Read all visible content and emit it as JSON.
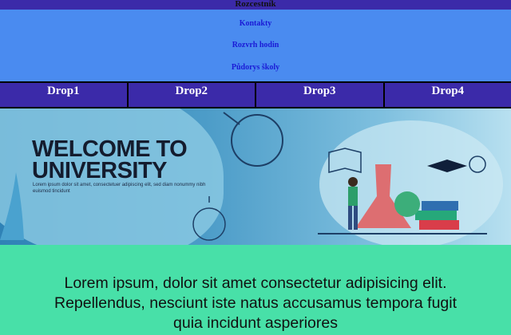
{
  "header": {
    "title": "Rozcestník"
  },
  "links": [
    "Kontakty",
    "Rozvrh hodin",
    "Půdorys školy"
  ],
  "dropdowns": [
    "Drop1",
    "Drop2",
    "Drop3",
    "Drop4"
  ],
  "banner": {
    "headline_line1": "WELCOME TO",
    "headline_line2": "UNIVERSITY",
    "subtext": "Lorem ipsum dolor sit amet, consectetuer adipiscing elit, sed diam nonummy nibh euismod tincidunt"
  },
  "content": {
    "text": "Lorem ipsum, dolor sit amet consectetur adipisicing elit. Repellendus, nesciunt iste natus accusamus tempora fugit quia incidunt asperiores"
  },
  "colors": {
    "topbar": "#3b2aa9",
    "linkbar": "#4a8bf0",
    "content_bg": "#48e0a8",
    "link": "#1a1ad6"
  }
}
